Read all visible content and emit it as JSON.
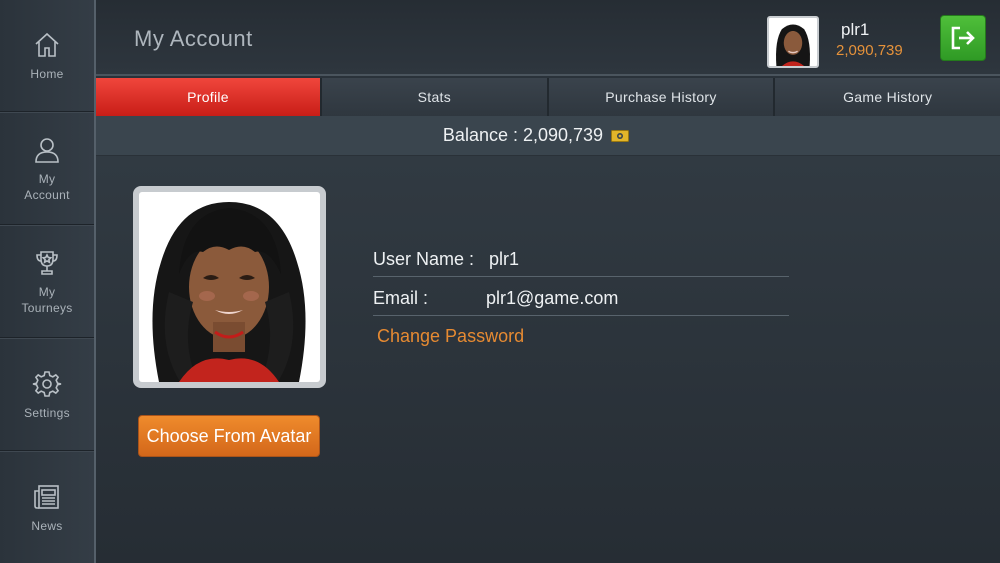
{
  "sidebar": {
    "items": [
      {
        "label": "Home",
        "icon": "home-icon"
      },
      {
        "label": "My\nAccount",
        "icon": "user-icon"
      },
      {
        "label": "My\nTourneys",
        "icon": "trophy-icon"
      },
      {
        "label": "Settings",
        "icon": "gear-icon"
      },
      {
        "label": "News",
        "icon": "newspaper-icon"
      }
    ]
  },
  "header": {
    "title": "My Account",
    "username": "plr1",
    "balance": "2,090,739",
    "logout_icon": "logout-icon"
  },
  "tabs": [
    {
      "label": "Profile",
      "active": true
    },
    {
      "label": "Stats",
      "active": false
    },
    {
      "label": "Purchase History",
      "active": false
    },
    {
      "label": "Game History",
      "active": false
    }
  ],
  "balance_bar": {
    "text": "Balance : 2,090,739",
    "icon": "cash-icon"
  },
  "profile": {
    "choose_avatar_label": "Choose From Avatar",
    "username_label": "User Name :",
    "username_value": "plr1",
    "email_label": "Email :",
    "email_value": "plr1@game.com",
    "change_password_label": "Change Password"
  },
  "colors": {
    "accent_red": "#e0302a",
    "accent_orange": "#e6923a",
    "logout_green": "#3fae30",
    "background": "#2a323a"
  }
}
